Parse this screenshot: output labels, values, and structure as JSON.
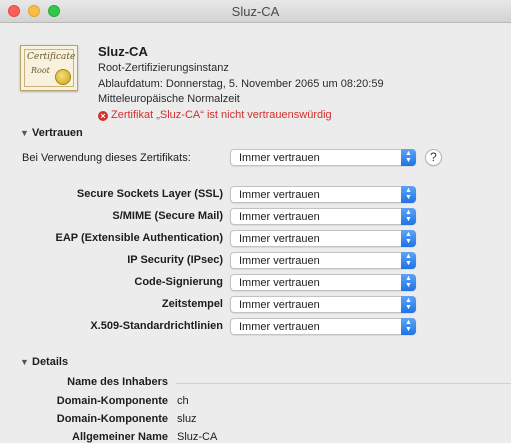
{
  "window": {
    "title": "Sluz-CA"
  },
  "certificate": {
    "icon_text_1": "Certificate",
    "icon_text_2": "Root",
    "name": "Sluz-CA",
    "type": "Root-Zertifizierungsinstanz",
    "expiry": "Ablaufdatum: Donnerstag, 5. November 2065 um 08:20:59",
    "timezone": "Mitteleuropäische Normalzeit",
    "warning": "Zertifikat „Sluz-CA“ ist nicht vertrauenswürdig",
    "warning_color": "#d0312d"
  },
  "trust": {
    "section_label": "Vertrauen",
    "main_label": "Bei Verwendung dieses Zertifikats:",
    "main_value": "Immer vertrauen",
    "help_label": "?",
    "rows": [
      {
        "label": "Secure Sockets Layer (SSL)",
        "value": "Immer vertrauen"
      },
      {
        "label": "S/MIME (Secure Mail)",
        "value": "Immer vertrauen"
      },
      {
        "label": "EAP (Extensible Authentication)",
        "value": "Immer vertrauen"
      },
      {
        "label": "IP Security (IPsec)",
        "value": "Immer vertrauen"
      },
      {
        "label": "Code-Signierung",
        "value": "Immer vertrauen"
      },
      {
        "label": "Zeitstempel",
        "value": "Immer vertrauen"
      },
      {
        "label": "X.509-Standardrichtlinien",
        "value": "Immer vertrauen"
      }
    ]
  },
  "details": {
    "section_label": "Details",
    "subject_heading": "Name des Inhabers",
    "fields": [
      {
        "label": "Domain-Komponente",
        "value": "ch"
      },
      {
        "label": "Domain-Komponente",
        "value": "sluz"
      },
      {
        "label": "Allgemeiner Name",
        "value": "Sluz-CA"
      }
    ]
  },
  "colors": {
    "accent": "#1e73e8"
  }
}
